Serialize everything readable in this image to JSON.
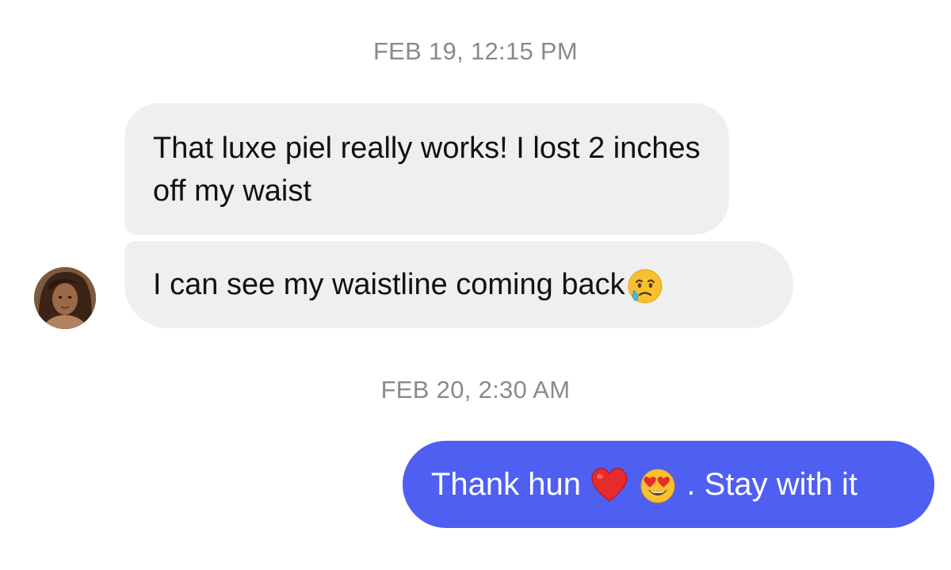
{
  "conversation": {
    "timestamps": [
      "FEB 19, 12:15 PM",
      "FEB 20, 2:30 AM"
    ],
    "incoming": [
      {
        "text": "That luxe piel really works! I lost 2 inches off my waist"
      },
      {
        "text": "I can see my waistline coming back",
        "emoji": "sad-but-relieved-face"
      }
    ],
    "outgoing": [
      {
        "text_before": "Thank hun",
        "emojis": [
          "red-heart",
          "smiling-face-with-heart-eyes"
        ],
        "text_after": ". Stay with it"
      }
    ]
  },
  "colors": {
    "incoming_bubble": "#efefef",
    "outgoing_bubble": "#4f5ff1",
    "timestamp": "#8a8a8e"
  },
  "icons": {
    "avatar": "contact-avatar"
  }
}
